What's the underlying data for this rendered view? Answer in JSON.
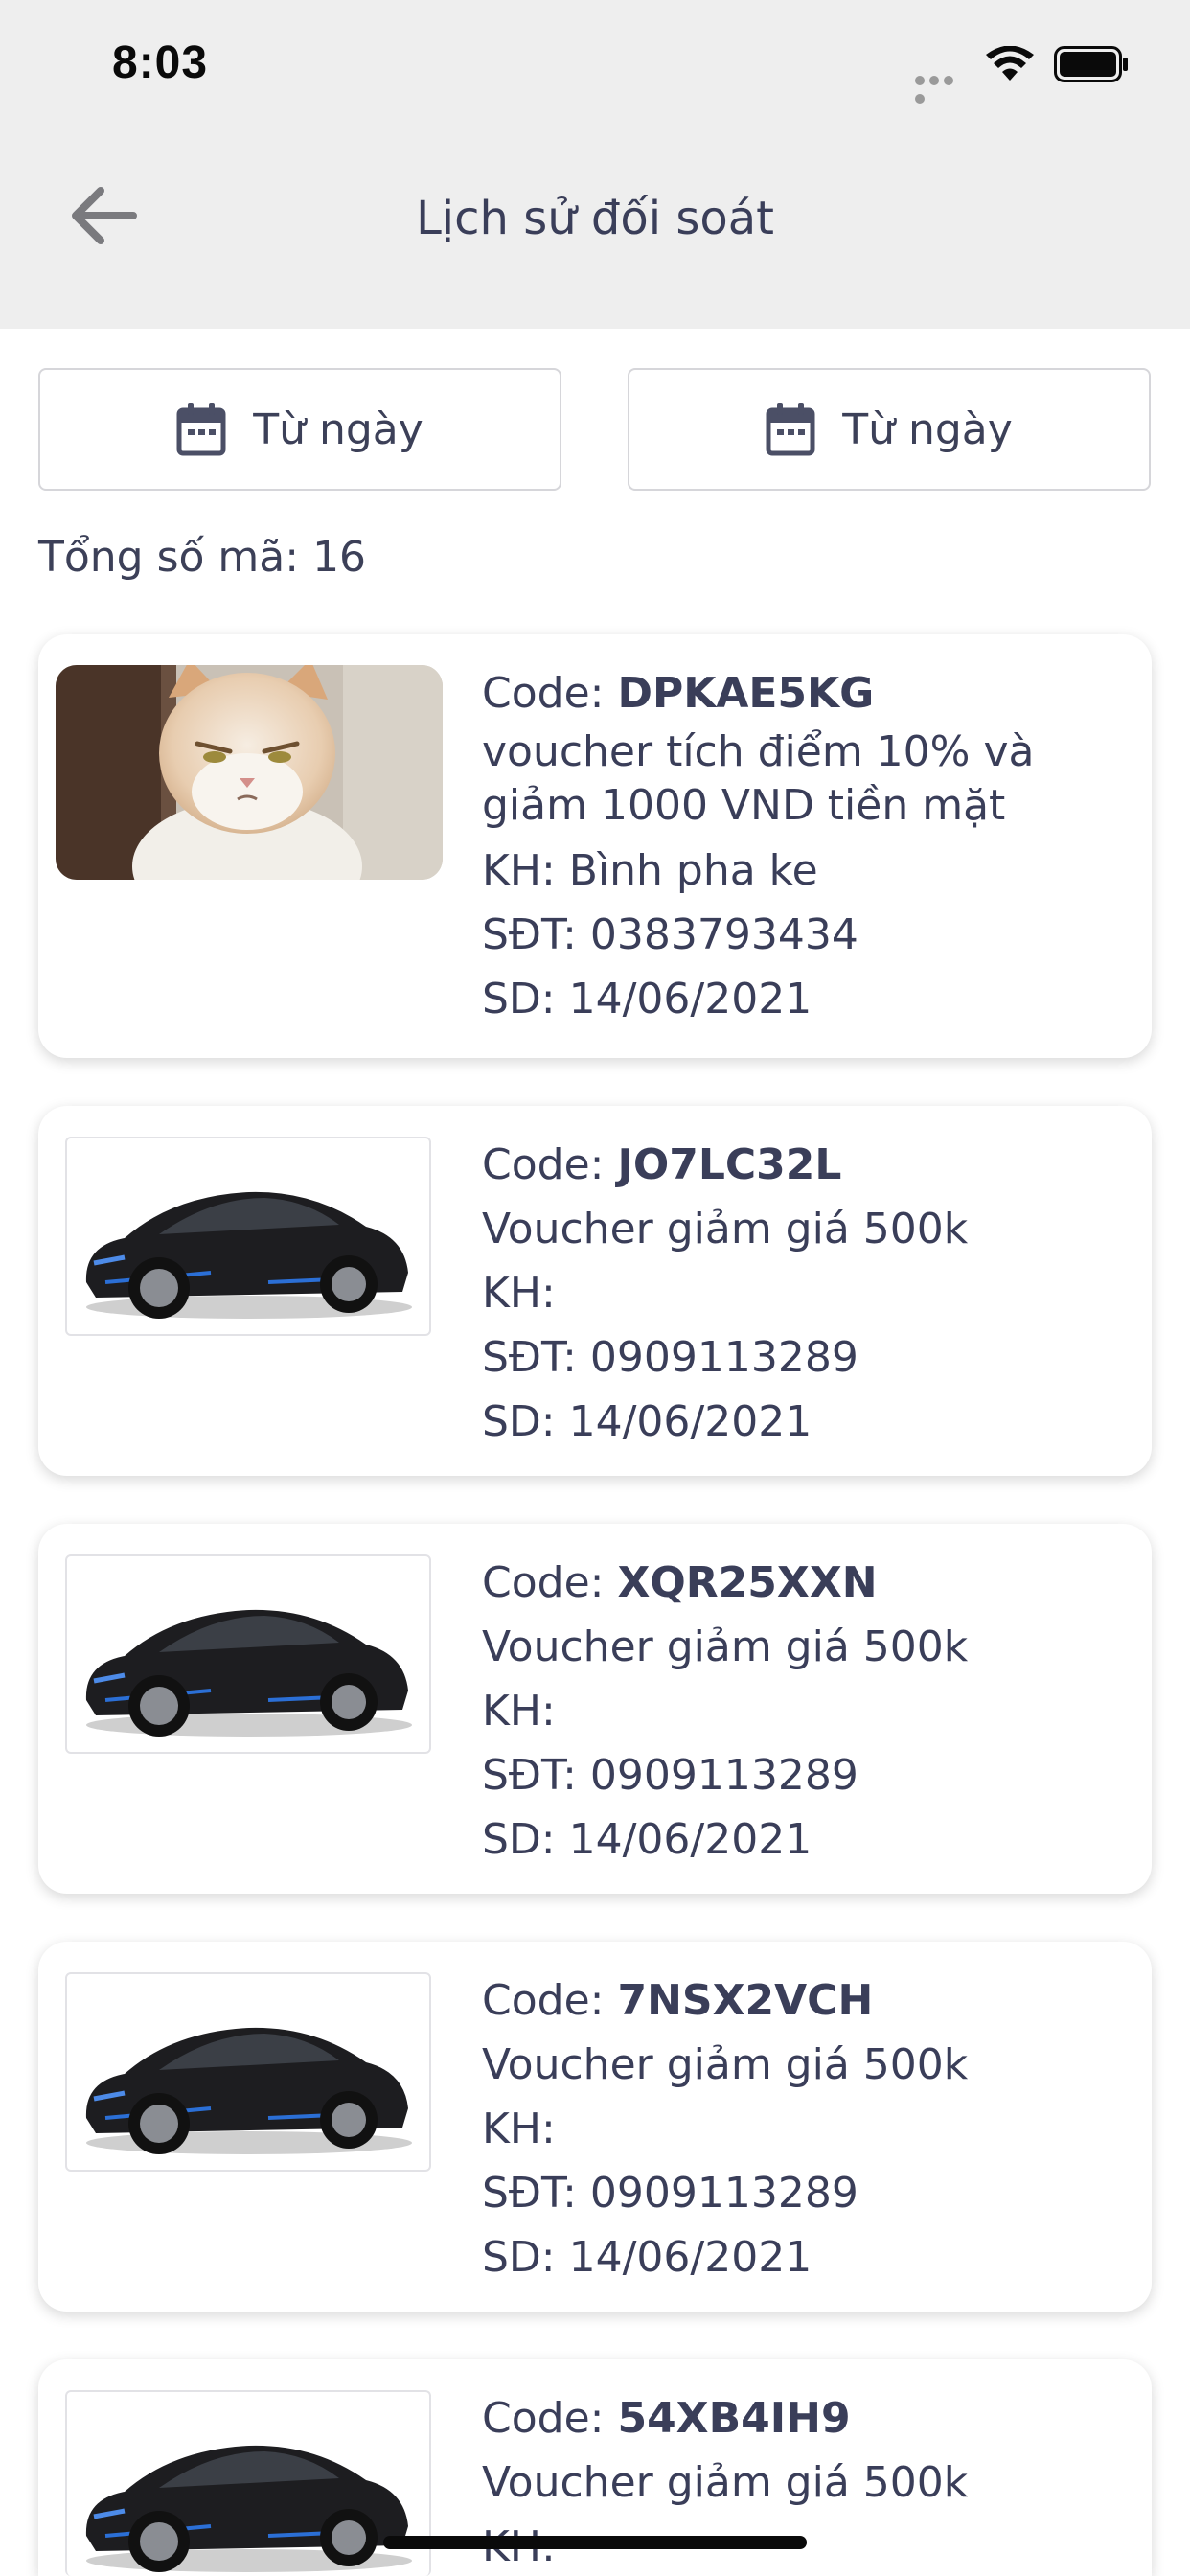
{
  "status_bar": {
    "time": "8:03"
  },
  "header": {
    "title": "Lịch sử đối soát",
    "back_icon": "arrow-left-icon"
  },
  "filters": {
    "from_label": "Từ ngày",
    "to_label": "Từ ngày",
    "icon": "calendar-icon"
  },
  "summary": {
    "total_text": "Tổng số mã: 16"
  },
  "vouchers": [
    {
      "code_prefix": "Code: ",
      "code": "DPKAE5KG",
      "description": "voucher tích điểm 10%  và giảm 1000 VND tiền mặt",
      "customer": "KH: Bình pha ke",
      "phone": "SĐT: 0383793434",
      "date": "SD: 14/06/2021",
      "image": "cat-photo"
    },
    {
      "code_prefix": "Code: ",
      "code": "JO7LC32L",
      "description": "Voucher giảm giá 500k",
      "customer": "KH:",
      "phone": "SĐT: 0909113289",
      "date": "SD: 14/06/2021",
      "image": "car-photo"
    },
    {
      "code_prefix": "Code: ",
      "code": "XQR25XXN",
      "description": "Voucher giảm giá 500k",
      "customer": "KH:",
      "phone": "SĐT: 0909113289",
      "date": "SD: 14/06/2021",
      "image": "car-photo"
    },
    {
      "code_prefix": "Code: ",
      "code": "7NSX2VCH",
      "description": "Voucher giảm giá 500k",
      "customer": "KH:",
      "phone": "SĐT: 0909113289",
      "date": "SD: 14/06/2021",
      "image": "car-photo"
    },
    {
      "code_prefix": "Code: ",
      "code": "54XB4IH9",
      "description": "Voucher giảm giá 500k",
      "customer": "KH:",
      "phone": "",
      "date": "",
      "image": "car-photo"
    }
  ],
  "colors": {
    "header_bg": "#eeeeee",
    "text": "#3a3e59",
    "card_bg": "#ffffff",
    "border": "#d6d6da"
  }
}
